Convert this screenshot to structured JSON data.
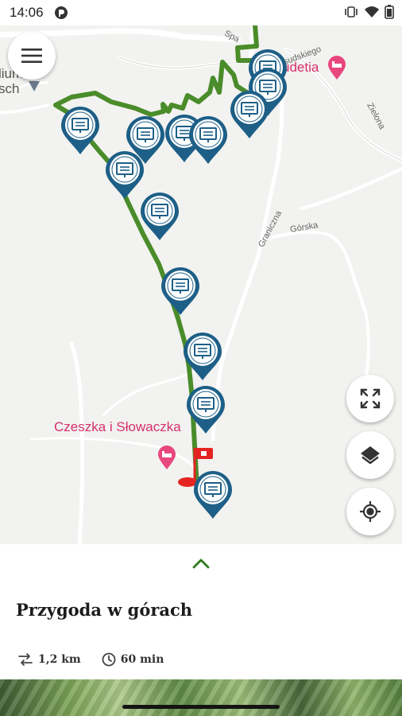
{
  "status_bar": {
    "time": "14:06",
    "icons": [
      "app-notification-icon",
      "vibrate-icon",
      "wifi-icon",
      "battery-icon"
    ]
  },
  "map": {
    "street_labels": [
      "Spa",
      "Piłsudskiego",
      "Zielona",
      "Graniczna",
      "Górska"
    ],
    "poi_labels": [
      "udetia",
      "Czeszka i Słowaczka"
    ],
    "place_label_partial": [
      "lium",
      "sch"
    ],
    "colors": {
      "route": "#4a8c2a",
      "marker": "#1d5f87",
      "poi": "#d6306e",
      "start_flag": "#e52421"
    },
    "controls": {
      "menu": "menu-icon",
      "fullscreen": "fullscreen-icon",
      "layers": "layers-icon",
      "locate": "locate-icon"
    },
    "route_points": 13
  },
  "sheet": {
    "handle_icon": "chevron-up-icon",
    "title": "Przygoda w górach",
    "distance": "1,2 km",
    "duration": "60 min"
  }
}
